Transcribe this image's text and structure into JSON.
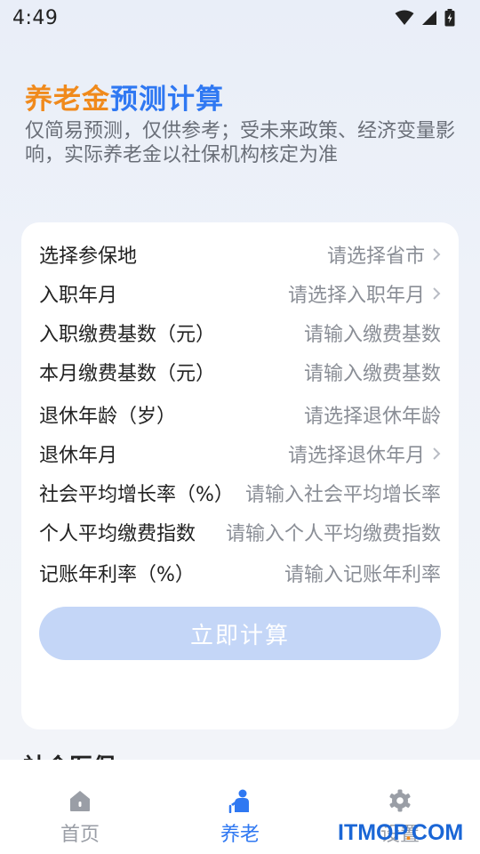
{
  "status_bar": {
    "time": "4:49"
  },
  "header": {
    "title_orange": "养老金",
    "title_blue": "预测计算",
    "subtitle_line1": "仅简易预测，仅供参考；受未来政策、经济变量影",
    "subtitle_line2": "响，实际养老金以社保机构核定为准"
  },
  "form": {
    "rows": [
      {
        "label": "选择参保地",
        "value": "请选择省市",
        "chevron": true
      },
      {
        "label": "入职年月",
        "value": "请选择入职年月",
        "chevron": true
      },
      {
        "label": "入职缴费基数（元）",
        "value": "请输入缴费基数",
        "chevron": false
      },
      {
        "label": "本月缴费基数（元）",
        "value": "请输入缴费基数",
        "chevron": false
      },
      {
        "label": "退休年龄（岁）",
        "value": "请选择退休年龄",
        "chevron": false
      },
      {
        "label": "退休年月",
        "value": "请选择退休年月",
        "chevron": true
      },
      {
        "label": "社会平均增长率（%）",
        "value": "请输入社会平均增长率",
        "chevron": false
      },
      {
        "label": "个人平均缴费指数",
        "value": "请输入个人平均缴费指数",
        "chevron": false
      },
      {
        "label": "记账年利率（%）",
        "value": "请输入记账年利率",
        "chevron": false
      }
    ],
    "submit_label": "立即计算"
  },
  "next_section_title": "社会医保",
  "tab_bar": {
    "tabs": [
      {
        "label": "首页",
        "icon": "home-icon",
        "active": false
      },
      {
        "label": "养老",
        "icon": "elderly-person-icon",
        "active": true
      },
      {
        "label": "设置",
        "icon": "gear-icon",
        "active": false
      }
    ]
  },
  "watermark": {
    "part1": "ITMOP",
    "part2": ".",
    "part3": "COM"
  },
  "colors": {
    "accent_blue": "#2f78f2",
    "accent_orange": "#f08a1c",
    "button_disabled": "#c4d6f7"
  }
}
